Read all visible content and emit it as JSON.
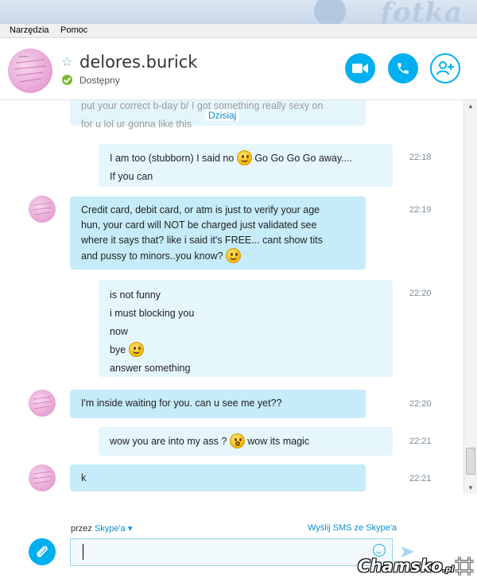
{
  "menu": {
    "tools": "Narzędzia",
    "help": "Pomoc"
  },
  "header": {
    "contact_name": "delores.burick",
    "status": "Dostępny"
  },
  "chat": {
    "partial_message": {
      "line1": "put your correct b-day b/ I got something really sexy on",
      "line2": "for u lol ur gonna like this",
      "date_label": "Dzisiaj"
    },
    "messages": [
      {
        "dir": "out",
        "time": "22:18",
        "lines": [
          "I am too (stubborn)   I said no",
          "Go Go Go Go away....",
          "If you can"
        ]
      },
      {
        "dir": "in",
        "time": "22:19",
        "lines": [
          "Credit card, debit card, or atm is just to verify your age",
          "hun, your card will NOT be charged just validated see",
          "where it says that? like i said it's FREE... cant show tits",
          "and pussy to minors..you know?"
        ]
      },
      {
        "dir": "out",
        "time": "22:20",
        "lines": [
          "is not funny",
          "i must blocking you",
          "now",
          "bye",
          "answer something"
        ]
      },
      {
        "dir": "in",
        "time": "22:20",
        "lines": [
          "I'm inside waiting for you. can u see me yet??"
        ]
      },
      {
        "dir": "out",
        "time": "22:21",
        "lines": [
          "wow you are into my ass ?",
          "wow its magic"
        ]
      },
      {
        "dir": "in",
        "time": "22:21",
        "lines": [
          "k"
        ]
      }
    ]
  },
  "compose": {
    "via_prefix": "przez",
    "via_link": "Skype'a",
    "sms_link": "Wyślij SMS ze Skype'a",
    "input_value": ""
  },
  "watermark": {
    "main": "Chamsko",
    "suffix": ".pl",
    "top_brand": "fotka"
  },
  "icons": {
    "video": "video-camera-icon",
    "call": "phone-icon",
    "add": "add-contact-icon",
    "attach": "paperclip-icon",
    "emoticon": "smiley-icon",
    "send": "send-icon"
  },
  "colors": {
    "accent": "#00aff0",
    "incoming": "#c6ebf9",
    "outgoing": "#e5f6fd",
    "online": "#7cb82f"
  }
}
